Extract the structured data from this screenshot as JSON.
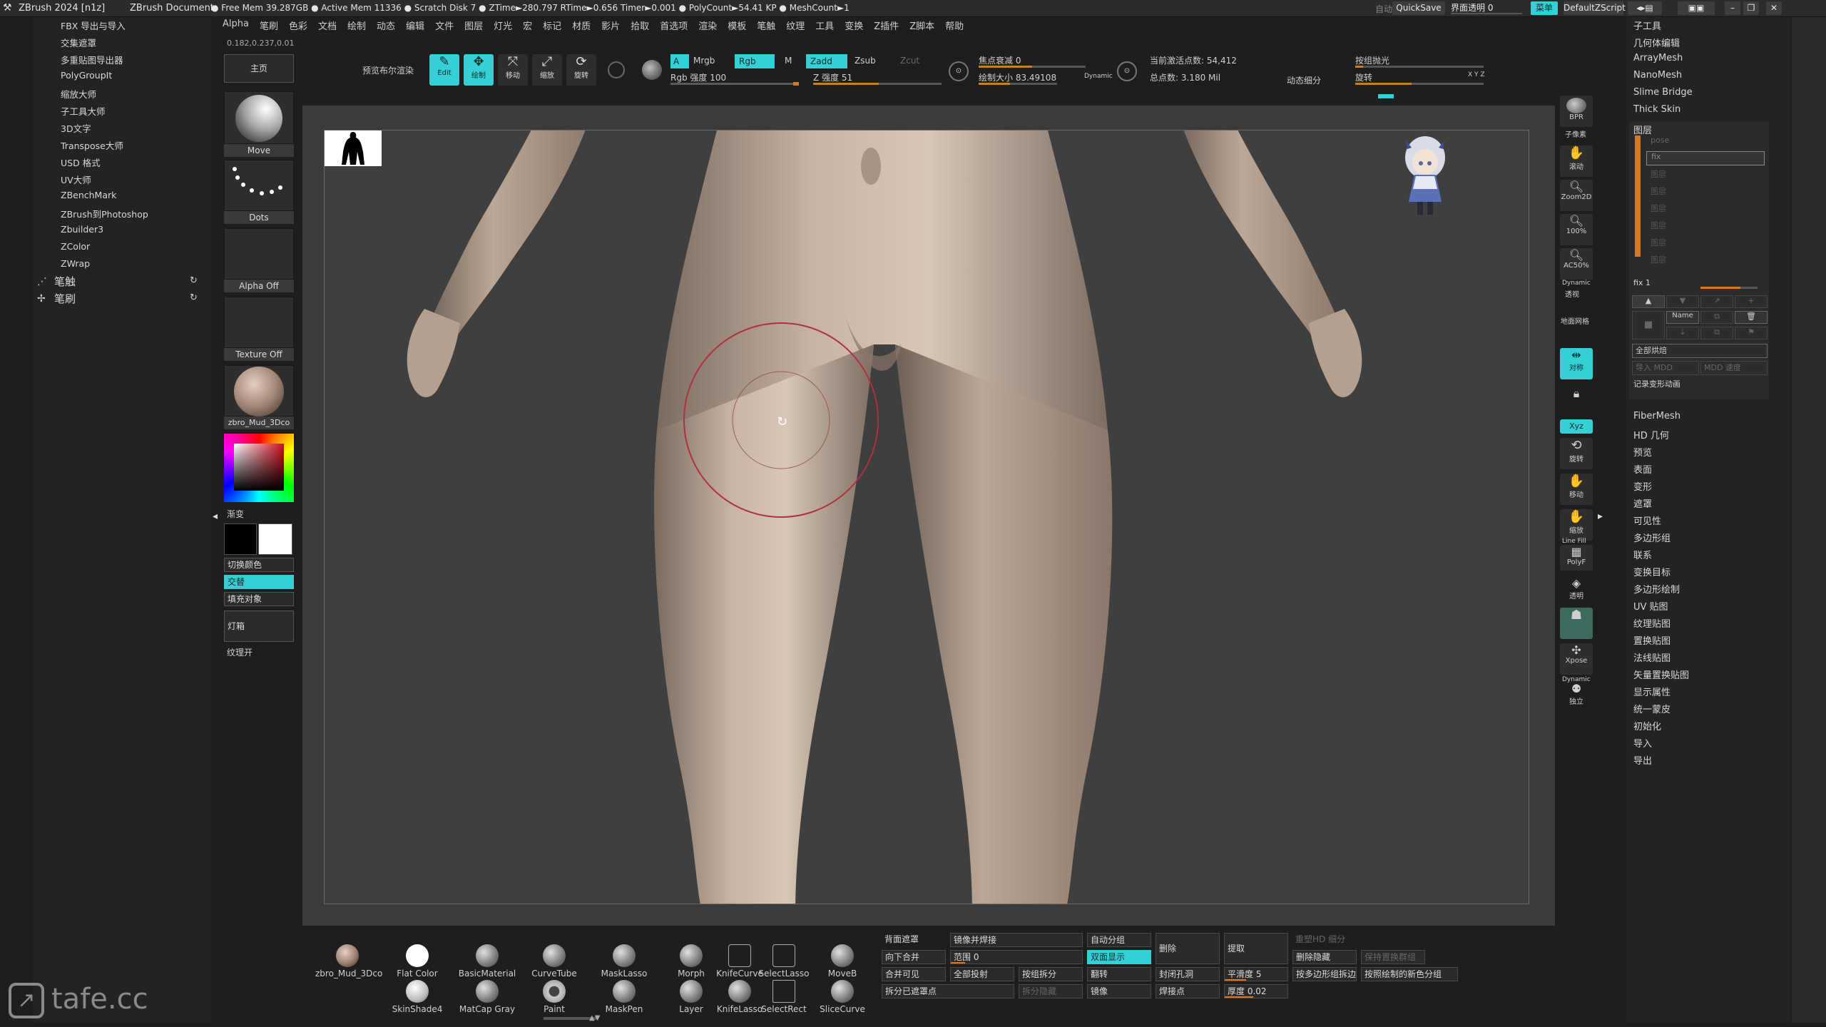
{
  "titlebar": {
    "app": "ZBrush 2024 [n1z]",
    "doc": "ZBrush Document",
    "stats": "● Free Mem 39.287GB ● Active Mem 11336 ● Scratch Disk 7 ● ZTime►280.797 RTime►0.656 Timer►0.001 ● PolyCount►54.41 KP ● MeshCount►1",
    "auto": "自动",
    "quicksave": "QuickSave",
    "transparency": "界面透明 0",
    "menu": "菜单",
    "zscript": "DefaultZScript"
  },
  "coords": "0.182,0.237,0.01",
  "menus": [
    "Alpha",
    "笔刷",
    "色彩",
    "文档",
    "绘制",
    "动态",
    "编辑",
    "文件",
    "图层",
    "灯光",
    "宏",
    "标记",
    "材质",
    "影片",
    "拾取",
    "首选项",
    "渲染",
    "模板",
    "笔触",
    "纹理",
    "工具",
    "变换",
    "Z插件",
    "Z脚本",
    "帮助"
  ],
  "plugins": [
    "FBX 导出与导入",
    "交集遮罩",
    "多重贴图导出器",
    "PolyGroupIt",
    "缩放大师",
    "子工具大师",
    "3D文字",
    "Transpose大师",
    "USD 格式",
    "UV大师",
    "ZBenchMark",
    "ZBrush到Photoshop",
    "Zbuilder3",
    "ZColor",
    "ZWrap"
  ],
  "leftpanel_sections": {
    "stroke": "笔触",
    "brush": "笔刷"
  },
  "toolcol": {
    "home": "主页",
    "brush": "Move",
    "stroke": "Dots",
    "alpha": "Alpha Off",
    "texture": "Texture Off",
    "material": "zbro_Mud_3Dco",
    "gradient": "渐变",
    "switch": "切换颜色",
    "alternate": "交替",
    "fill": "填充对象",
    "lightbox": "灯箱",
    "texture_on": "纹理开"
  },
  "shelf": {
    "bpr": "预览布尔渲染",
    "edit": "Edit",
    "draw": "绘制",
    "move": "移动",
    "scale": "缩放",
    "rotate": "旋转",
    "a": "A",
    "mrgb": "Mrgb",
    "rgb": "Rgb",
    "m": "M",
    "zadd": "Zadd",
    "zsub": "Zsub",
    "zcut": "Zcut",
    "rgb_intensity": "Rgb 强度 100",
    "z_intensity": "Z 强度 51",
    "focal": "焦点衰减 0",
    "draw_size": "绘制大小 83.49108",
    "dynamic": "Dynamic",
    "active_points": "当前激活点数: 54,412",
    "total_points": "总点数: 3.180 Mil",
    "dyn_sub": "动态细分",
    "groups_lights": "按组抛光",
    "rotate_label": "旋转",
    "xyz": "X Y Z"
  },
  "rightcol": [
    "BPR",
    "子像素",
    "滚动",
    "缩放",
    "Zoom2D",
    "100%",
    "AC50%",
    "Dynamic",
    "透视",
    "地面网格",
    "对称",
    "锁定",
    "Xyz",
    "旋转",
    "移动",
    "缩放",
    "Line Fill",
    "PolyF",
    "透明",
    "Ghost",
    "Xpose",
    "Dynamic",
    "独立"
  ],
  "rightpanel": {
    "top": [
      "子工具",
      "几何体编辑",
      "ArrayMesh",
      "NanoMesh",
      "Slime Bridge",
      "Thick Skin"
    ],
    "layers_title": "图层",
    "layer_rows": [
      "pose",
      "fix",
      "图层",
      "图层",
      "图层",
      "图层",
      "图层",
      "图层"
    ],
    "fix1": "fix 1",
    "name_btn": "Name",
    "bake_all": "全部烘焙",
    "import_mdd": "导入 MDD",
    "mdd_speed": "MDD 速度",
    "record": "记录变形动画",
    "bottom": [
      "FiberMesh",
      "HD 几何",
      "预览",
      "表面",
      "变形",
      "遮罩",
      "可见性",
      "多边形组",
      "联系",
      "变换目标",
      "多边形绘制",
      "UV 贴图",
      "纹理贴图",
      "置换贴图",
      "法线贴图",
      "矢量置换贴图",
      "显示属性",
      "统一蒙皮",
      "初始化",
      "导入",
      "导出"
    ]
  },
  "bottomshelf": {
    "brushes_row1": [
      "zbro_Mud_3Dco",
      "Flat Color",
      "BasicMaterial",
      "CurveTube",
      "MaskLasso",
      "Morph",
      "KnifeCurve",
      "SelectLasso",
      "MoveB"
    ],
    "brushes_row2": [
      "SkinShade4",
      "MatCap Gray",
      "Paint",
      "MaskPen",
      "Layer",
      "KnifeLasso",
      "SelectRect",
      "SliceCurve"
    ],
    "ops": {
      "bg_mask": "背面遮罩",
      "merge_down": "向下合并",
      "merge_visible": "合并可见",
      "split_hidden": "拆分已遮罩点",
      "mirror_weld": "镜像并焊接",
      "range": "范围 0",
      "project_all": "全部投射",
      "split_by": "按组拆分",
      "split_unmasked": "拆分隐藏",
      "auto_group": "自动分组",
      "double": "双面显示",
      "flip": "翻转",
      "mirror": "镜像",
      "delete": "删除",
      "close_holes": "封闭孔洞",
      "weld": "焊接点",
      "extract": "提取",
      "smooth": "平滑度 5",
      "thickness": "厚度 0.02",
      "del_hidden": "删除隐藏",
      "group_split": "按多边形组拆边",
      "by_draw": "按照绘制的新色分组",
      "hd_sub": "重塑HD 细分",
      "poly_visible": "保持置换群组"
    }
  },
  "watermark": "tafe.cc"
}
